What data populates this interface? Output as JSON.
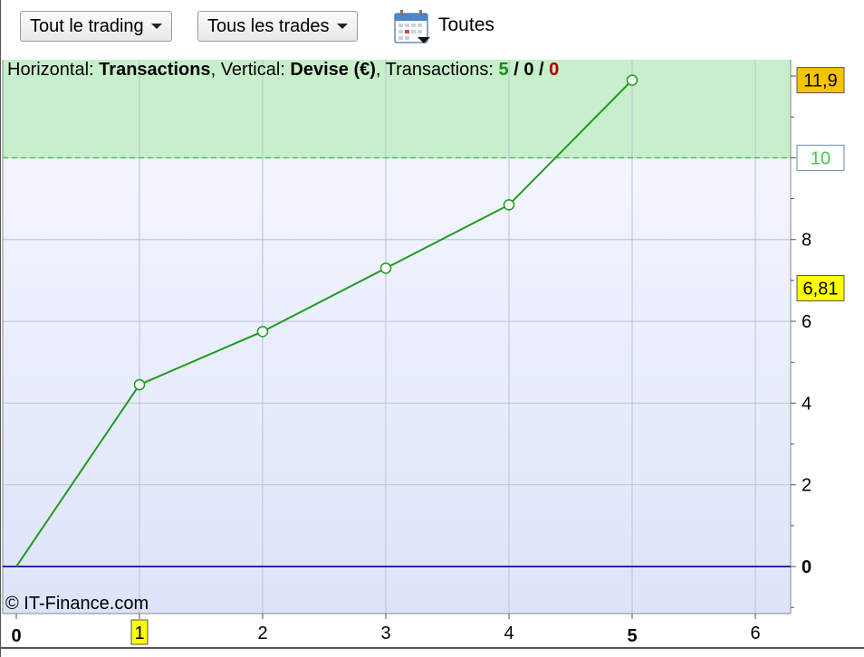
{
  "toolbar": {
    "trading_select": "Tout le trading",
    "trades_select": "Tous les trades",
    "period_label": "Toutes",
    "period_icon": "calendar-icon"
  },
  "info": {
    "horizontal_label": "Horizontal:",
    "horizontal_value": "Transactions",
    "vertical_label": "Vertical:",
    "vertical_value": "Devise (€)",
    "transactions_label": "Transactions:",
    "count_total": "5",
    "count_zero": "0",
    "count_red": "0",
    "separator": "/"
  },
  "copyright": "© IT-Finance.com",
  "colors": {
    "line": "#1f9a1f",
    "profit_zone": "#c8efcc",
    "target_line": "#4cc44c",
    "zero_line": "#2a2aa0",
    "badge_yellow": "#ffff00",
    "badge_orange": "#f5c400",
    "count_green": "#1a8a1a",
    "count_red": "#aa0000"
  },
  "chart_data": {
    "type": "line",
    "x": [
      0,
      1,
      2,
      3,
      4,
      5
    ],
    "y": [
      0,
      4.45,
      5.75,
      7.3,
      8.85,
      11.9
    ],
    "xlim": [
      0,
      6.3
    ],
    "ylim": [
      -1.15,
      12.4
    ],
    "x_ticks": [
      "0",
      "1",
      "2",
      "3",
      "4",
      "5",
      "6"
    ],
    "y_ticks": [
      "0",
      "2",
      "4",
      "6",
      "8",
      "10"
    ],
    "bold_x_ticks": [
      "0",
      "5"
    ],
    "highlighted_x_tick": "1",
    "target_level": 10,
    "target_label": "10",
    "max_label": "11,9",
    "avg_label": "6,81",
    "avg_level": 6.81,
    "grid": true
  }
}
